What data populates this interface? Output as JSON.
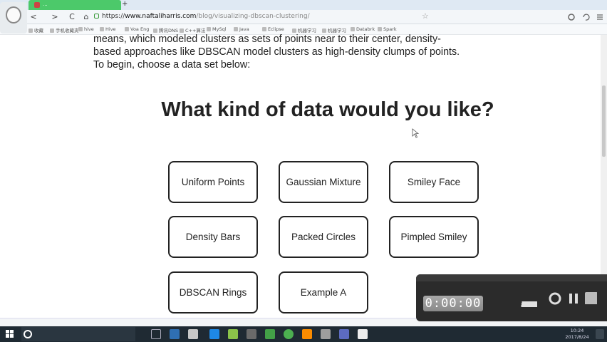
{
  "browser": {
    "tab_title": "...",
    "new_tab_label": "+",
    "back_label": "<",
    "forward_label": ">",
    "reload_label": "C",
    "home_label": "⌂",
    "url_scheme": "https://",
    "url_host": "www.naftaliharris.com",
    "url_path": "/blog/visualizing-dbscan-clustering/",
    "bookmarks": [
      "收藏",
      "手机收藏夹",
      "hive",
      "Hive",
      "Voa Eng",
      "腾讯DNS",
      "C++算法",
      "MySql",
      "Java",
      "Eclipse",
      "机器学习",
      "机器学习",
      "Databrk",
      "Spark"
    ]
  },
  "page": {
    "intro_text": "means, which modeled clusters as sets of points near to their center, density-based approaches like DBSCAN model clusters as high-density clumps of points. To begin, choose a data set below:",
    "question": "What kind of data would you like?",
    "choices": [
      "Uniform Points",
      "Gaussian Mixture",
      "Smiley Face",
      "Density Bars",
      "Packed Circles",
      "Pimpled Smiley",
      "DBSCAN Rings",
      "Example A"
    ]
  },
  "recorder": {
    "timer": "0:00:00"
  },
  "taskbar": {
    "time": "10:24",
    "date": "2017/8/24"
  }
}
